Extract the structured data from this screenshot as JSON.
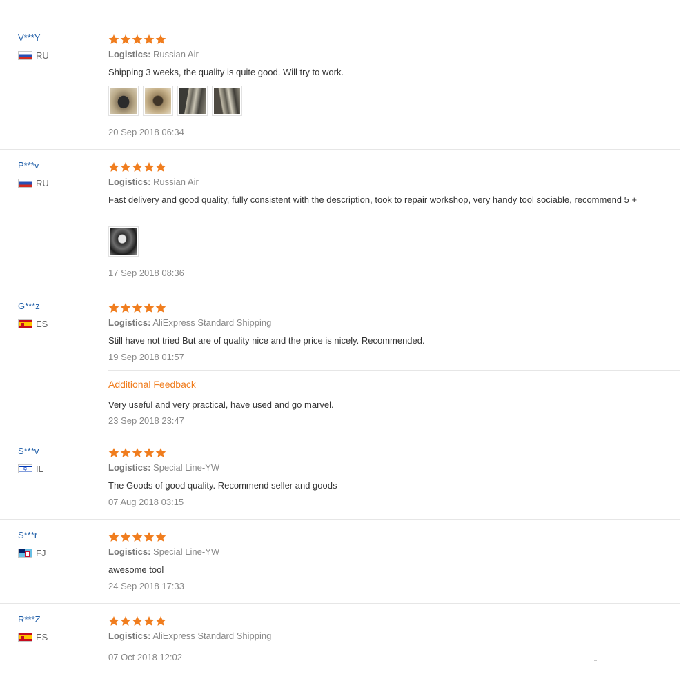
{
  "rating_stars": 5,
  "star_color": "#f07d1e",
  "logistics_label": "Logistics:",
  "reviews": [
    {
      "user": "V***Y",
      "country": "RU",
      "logistics": "Russian Air",
      "text": "Shipping 3 weeks, the quality is quite good. Will try to work.",
      "photos": [
        "photo-1",
        "photo-2",
        "photo-3",
        "photo-4"
      ],
      "date": "20 Sep 2018 06:34"
    },
    {
      "user": "P***v",
      "country": "RU",
      "logistics": "Russian Air",
      "text": "Fast delivery and good quality, fully consistent with the description, took to repair workshop, very handy tool sociable, recommend 5 +",
      "photos": [
        "photo-1"
      ],
      "date": "17 Sep 2018 08:36"
    },
    {
      "user": "G***z",
      "country": "ES",
      "logistics": "AliExpress Standard Shipping",
      "text": "Still have not tried But are of quality nice and the price is nicely. Recommended.",
      "date": "19 Sep 2018 01:57",
      "additional_feedback": {
        "title": "Additional Feedback",
        "text": "Very useful and very practical, have used and go marvel.",
        "date": "23 Sep 2018 23:47"
      }
    },
    {
      "user": "S***v",
      "country": "IL",
      "logistics": "Special Line-YW",
      "text": "The Goods of good quality. Recommend seller and goods",
      "date": "07 Aug 2018 03:15"
    },
    {
      "user": "S***r",
      "country": "FJ",
      "logistics": "Special Line-YW",
      "text": "awesome tool",
      "date": "24 Sep 2018 17:33"
    },
    {
      "user": "R***Z",
      "country": "ES",
      "logistics": "AliExpress Standard Shipping",
      "date": "07 Oct 2018 12:02"
    }
  ]
}
